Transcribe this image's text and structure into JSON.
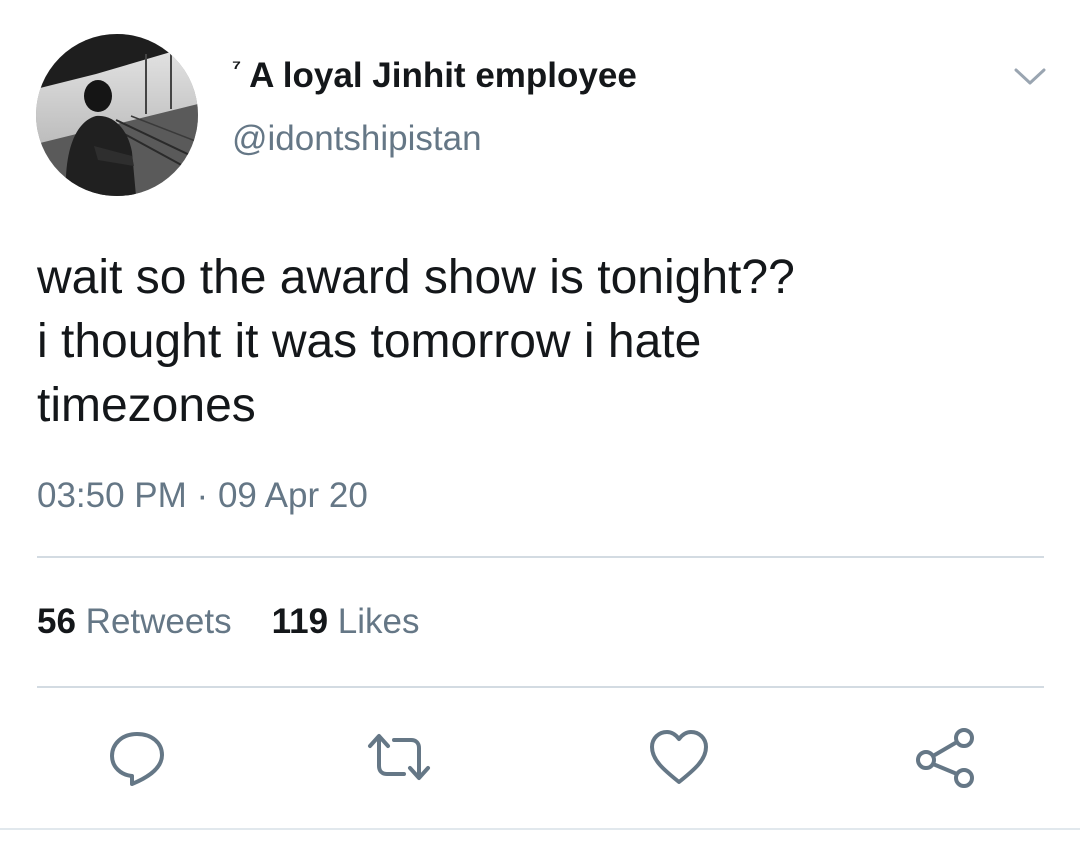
{
  "tweet": {
    "author": {
      "emoji": "⁷",
      "display_name": "A loyal Jinhit employee",
      "handle": "@idontshipistan"
    },
    "text": "wait so the award show is tonight??\ni thought it was tomorrow i hate\ntimezones",
    "time": "03:50 PM",
    "separator": "·",
    "date": "09 Apr 20"
  },
  "stats": {
    "retweets_count": "56",
    "retweets_label": "Retweets",
    "likes_count": "119",
    "likes_label": "Likes"
  },
  "icons": {
    "menu": "chevron-down-icon",
    "reply": "reply-icon",
    "retweet": "retweet-icon",
    "like": "heart-icon",
    "share": "share-icon"
  },
  "colors": {
    "text_primary": "#14171a",
    "text_secondary": "#657786",
    "divider": "#d3dbe2",
    "icon": "#657786"
  }
}
